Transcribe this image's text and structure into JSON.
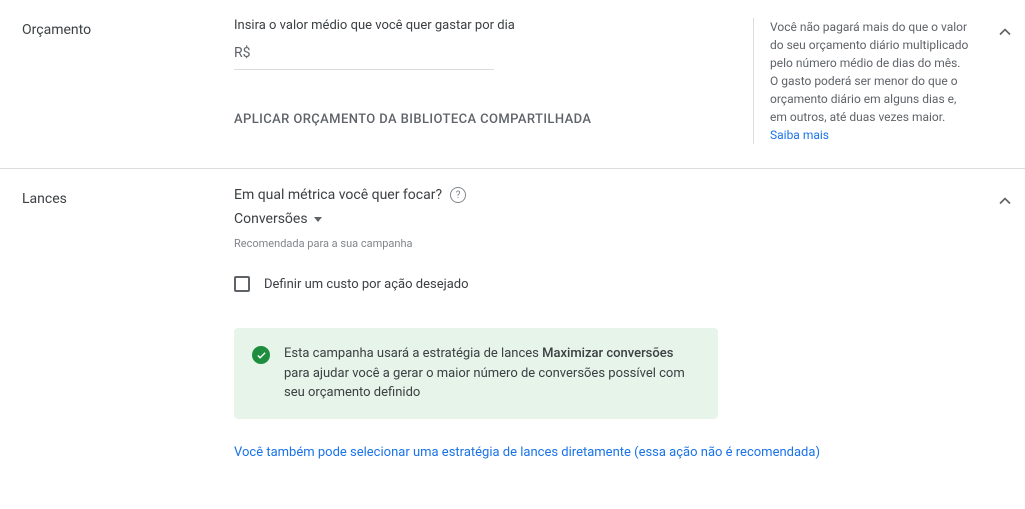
{
  "budget": {
    "section_label": "Orçamento",
    "field_label": "Insira o valor médio que você quer gastar por dia",
    "currency_prefix": "R$",
    "apply_library": "APLICAR ORÇAMENTO DA BIBLIOTECA COMPARTILHADA",
    "help_text": "Você não pagará mais do que o valor do seu orçamento diário multiplicado pelo número médio de dias do mês. O gasto poderá ser menor do que o orçamento diário em alguns dias e, em outros, até duas vezes maior.",
    "learn_more": "Saiba mais"
  },
  "bids": {
    "section_label": "Lances",
    "question": "Em qual métrica você quer focar?",
    "dropdown_value": "Conversões",
    "recommended": "Recomendada para a sua campanha",
    "checkbox_label": "Definir um custo por ação desejado",
    "notice_pre": "Esta campanha usará a estratégia de lances ",
    "notice_strong": "Maximizar conversões",
    "notice_post": " para ajudar você a gerar o maior número de conversões possível com seu orçamento definido",
    "alt_link": "Você também pode selecionar uma estratégia de lances diretamente (essa ação não é recomendada)"
  }
}
